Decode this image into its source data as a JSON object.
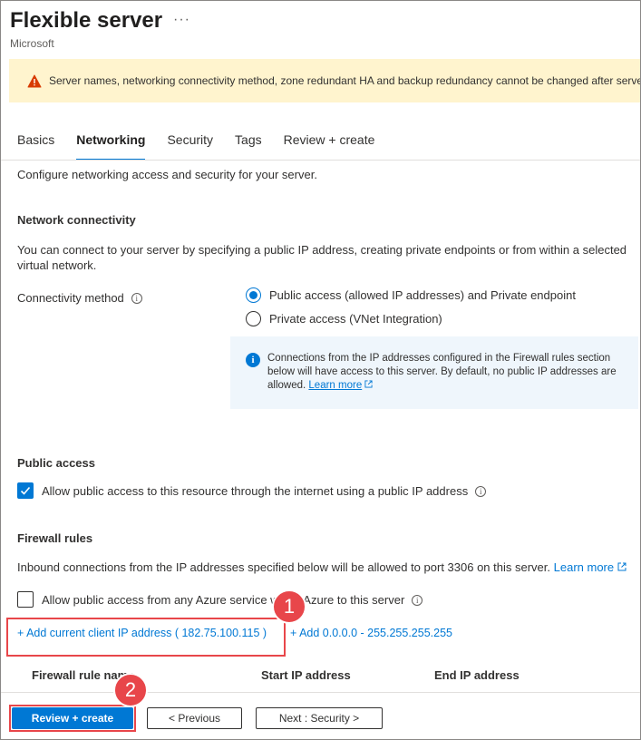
{
  "header": {
    "title": "Flexible server",
    "more_label": "···",
    "subtitle": "Microsoft"
  },
  "warning": {
    "text": "Server names, networking connectivity method, zone redundant HA and backup redundancy cannot be changed after server creation."
  },
  "tabs": [
    {
      "label": "Basics",
      "active": false
    },
    {
      "label": "Networking",
      "active": true
    },
    {
      "label": "Security",
      "active": false
    },
    {
      "label": "Tags",
      "active": false
    },
    {
      "label": "Review + create",
      "active": false
    }
  ],
  "intro": "Configure networking access and security for your server.",
  "network_connectivity": {
    "heading": "Network connectivity",
    "description": "You can connect to your server by specifying a public IP address, creating private endpoints or from within a selected virtual network.",
    "method_label": "Connectivity method",
    "options": [
      {
        "label": "Public access (allowed IP addresses) and Private endpoint",
        "selected": true
      },
      {
        "label": "Private access (VNet Integration)",
        "selected": false
      }
    ],
    "info_text": "Connections from the IP addresses configured in the Firewall rules section below will have access to this server. By default, no public IP addresses are allowed.",
    "learn_more": "Learn more"
  },
  "public_access": {
    "heading": "Public access",
    "checkbox_label": "Allow public access to this resource through the internet using a public IP address",
    "checked": true
  },
  "firewall": {
    "heading": "Firewall rules",
    "description": "Inbound connections from the IP addresses specified below will be allowed to port 3306 on this server.",
    "learn_more": "Learn more",
    "azure_checkbox_label": "Allow public access from any Azure service within Azure to this server",
    "add_client_ip": "+ Add current client IP address ( 182.75.100.115 )",
    "add_all": "+ Add 0.0.0.0 - 255.255.255.255",
    "columns": [
      "Firewall rule name",
      "Start IP address",
      "End IP address"
    ]
  },
  "annotations": {
    "badge1": "1",
    "badge2": "2",
    "accent": "#e8464a"
  },
  "footer": {
    "review_create": "Review + create",
    "previous": "< Previous",
    "next": "Next : Security >"
  },
  "colors": {
    "primary": "#0078d4",
    "warning_bg": "#fff4ce",
    "info_bg": "#eff6fc"
  }
}
